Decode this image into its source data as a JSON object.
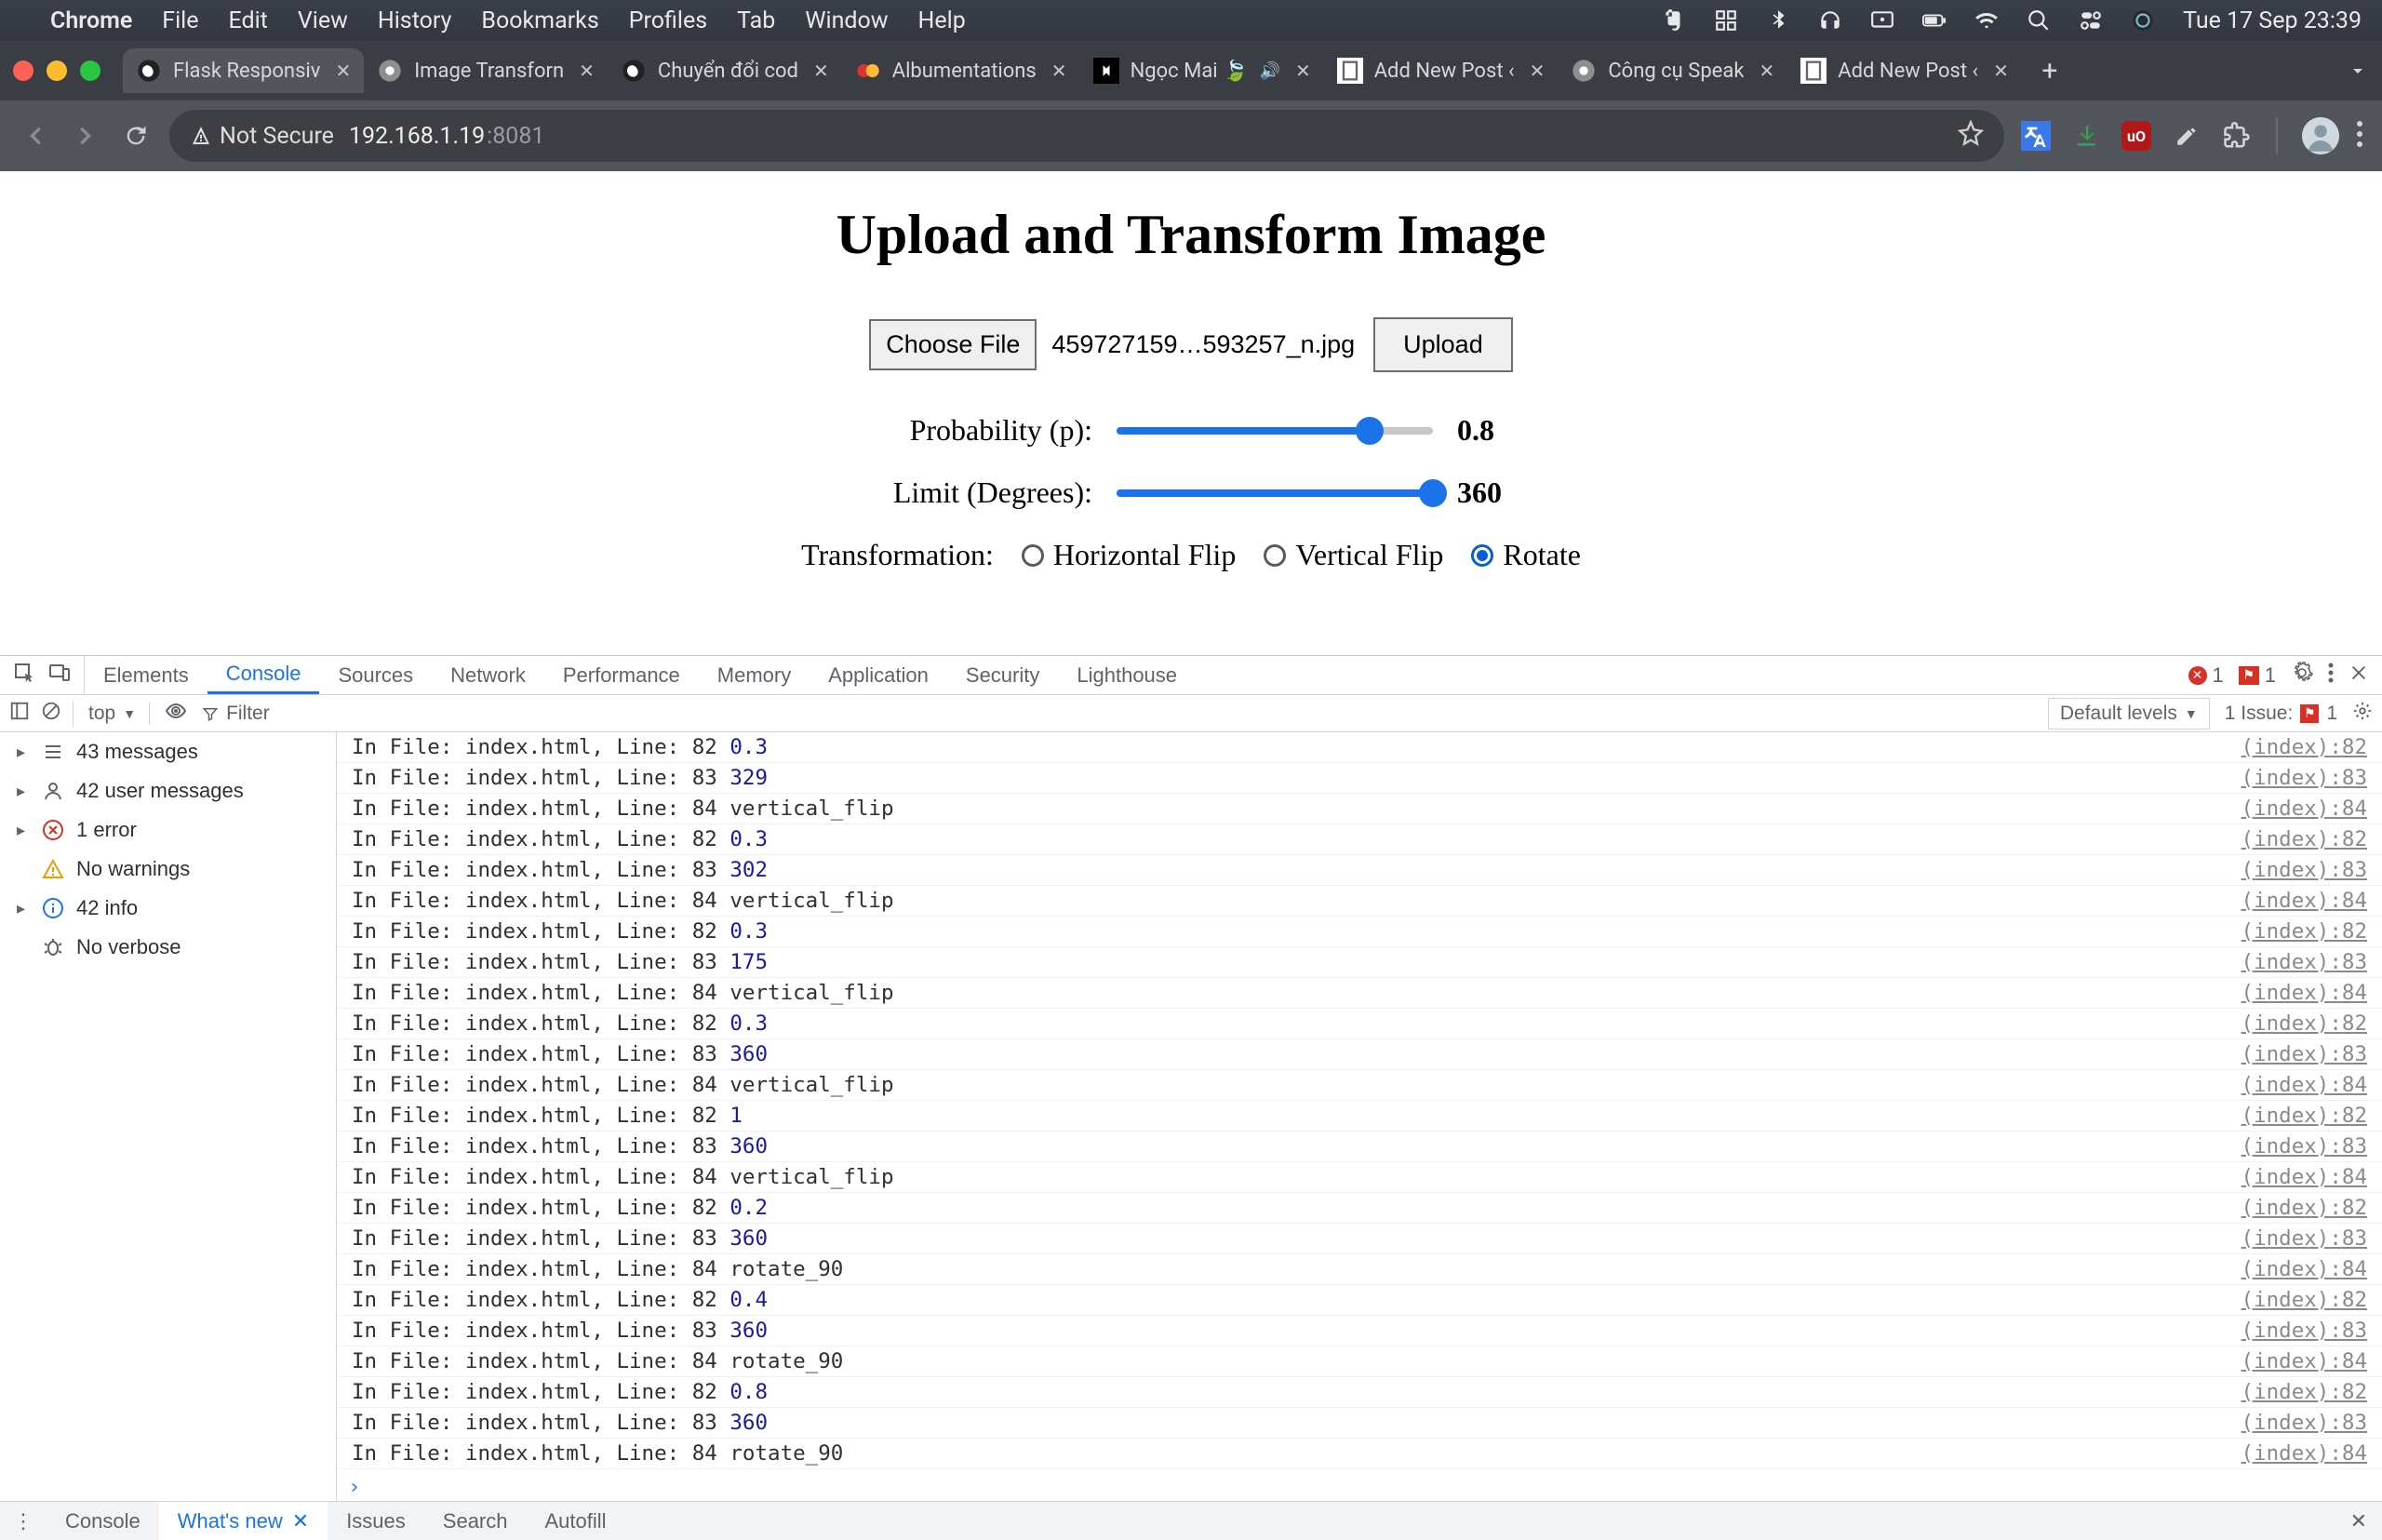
{
  "menubar": {
    "app": "Chrome",
    "items": [
      "File",
      "Edit",
      "View",
      "History",
      "Bookmarks",
      "Profiles",
      "Tab",
      "Window",
      "Help"
    ],
    "clock": "Tue 17 Sep  23:39"
  },
  "tabs": [
    {
      "title": "Flask Responsiv",
      "active": true
    },
    {
      "title": "Image Transforn"
    },
    {
      "title": "Chuyển đổi cod"
    },
    {
      "title": "Albumentations"
    },
    {
      "title": "Ngọc Mai 🍃",
      "audio": true
    },
    {
      "title": "Add New Post ‹"
    },
    {
      "title": "Công cụ Speak"
    },
    {
      "title": "Add New Post ‹"
    }
  ],
  "toolbar": {
    "secure_label": "Not Secure",
    "url_host": "192.168.1.19",
    "url_port": ":8081"
  },
  "page": {
    "heading": "Upload and Transform Image",
    "choose_file": "Choose File",
    "file_name": "459727159…593257_n.jpg",
    "upload": "Upload",
    "prob_label": "Probability (p):",
    "prob_value": "0.8",
    "prob_percent": 80,
    "limit_label": "Limit (Degrees):",
    "limit_value": "360",
    "limit_percent": 100,
    "transformation_label": "Transformation:",
    "options": {
      "hflip": "Horizontal Flip",
      "vflip": "Vertical Flip",
      "rotate": "Rotate"
    },
    "selected_option": "rotate"
  },
  "devtools": {
    "tabs": [
      "Elements",
      "Console",
      "Sources",
      "Network",
      "Performance",
      "Memory",
      "Application",
      "Security",
      "Lighthouse"
    ],
    "active_tab": "Console",
    "error_count": "1",
    "warn_count": "1",
    "toolbar": {
      "context": "top",
      "filter_placeholder": "Filter",
      "levels": "Default levels",
      "issue_label": "1 Issue:",
      "issue_count": "1"
    },
    "sidebar": [
      {
        "icon": "list",
        "text": "43 messages",
        "caret": true
      },
      {
        "icon": "user",
        "text": "42 user messages",
        "caret": true
      },
      {
        "icon": "error",
        "text": "1 error",
        "caret": true
      },
      {
        "icon": "warn",
        "text": "No warnings"
      },
      {
        "icon": "info",
        "text": "42 info",
        "caret": true
      },
      {
        "icon": "debug",
        "text": "No verbose"
      }
    ],
    "log_lines": [
      {
        "pre": "In File: index.html, Line: 82",
        "val": "0.3",
        "num": true,
        "src": "(index):82"
      },
      {
        "pre": "In File: index.html, Line: 83",
        "val": "329",
        "num": true,
        "src": "(index):83"
      },
      {
        "pre": "In File: index.html, Line: 84",
        "val": "vertical_flip",
        "num": false,
        "src": "(index):84"
      },
      {
        "pre": "In File: index.html, Line: 82",
        "val": "0.3",
        "num": true,
        "src": "(index):82"
      },
      {
        "pre": "In File: index.html, Line: 83",
        "val": "302",
        "num": true,
        "src": "(index):83"
      },
      {
        "pre": "In File: index.html, Line: 84",
        "val": "vertical_flip",
        "num": false,
        "src": "(index):84"
      },
      {
        "pre": "In File: index.html, Line: 82",
        "val": "0.3",
        "num": true,
        "src": "(index):82"
      },
      {
        "pre": "In File: index.html, Line: 83",
        "val": "175",
        "num": true,
        "src": "(index):83"
      },
      {
        "pre": "In File: index.html, Line: 84",
        "val": "vertical_flip",
        "num": false,
        "src": "(index):84"
      },
      {
        "pre": "In File: index.html, Line: 82",
        "val": "0.3",
        "num": true,
        "src": "(index):82"
      },
      {
        "pre": "In File: index.html, Line: 83",
        "val": "360",
        "num": true,
        "src": "(index):83"
      },
      {
        "pre": "In File: index.html, Line: 84",
        "val": "vertical_flip",
        "num": false,
        "src": "(index):84"
      },
      {
        "pre": "In File: index.html, Line: 82",
        "val": "1",
        "num": true,
        "src": "(index):82"
      },
      {
        "pre": "In File: index.html, Line: 83",
        "val": "360",
        "num": true,
        "src": "(index):83"
      },
      {
        "pre": "In File: index.html, Line: 84",
        "val": "vertical_flip",
        "num": false,
        "src": "(index):84"
      },
      {
        "pre": "In File: index.html, Line: 82",
        "val": "0.2",
        "num": true,
        "src": "(index):82"
      },
      {
        "pre": "In File: index.html, Line: 83",
        "val": "360",
        "num": true,
        "src": "(index):83"
      },
      {
        "pre": "In File: index.html, Line: 84",
        "val": "rotate_90",
        "num": false,
        "src": "(index):84"
      },
      {
        "pre": "In File: index.html, Line: 82",
        "val": "0.4",
        "num": true,
        "src": "(index):82"
      },
      {
        "pre": "In File: index.html, Line: 83",
        "val": "360",
        "num": true,
        "src": "(index):83"
      },
      {
        "pre": "In File: index.html, Line: 84",
        "val": "rotate_90",
        "num": false,
        "src": "(index):84"
      },
      {
        "pre": "In File: index.html, Line: 82",
        "val": "0.8",
        "num": true,
        "src": "(index):82"
      },
      {
        "pre": "In File: index.html, Line: 83",
        "val": "360",
        "num": true,
        "src": "(index):83"
      },
      {
        "pre": "In File: index.html, Line: 84",
        "val": "rotate_90",
        "num": false,
        "src": "(index):84"
      }
    ],
    "footer_tabs": [
      "Console",
      "What's new",
      "Issues",
      "Search",
      "Autofill"
    ],
    "footer_active": "What's new"
  }
}
